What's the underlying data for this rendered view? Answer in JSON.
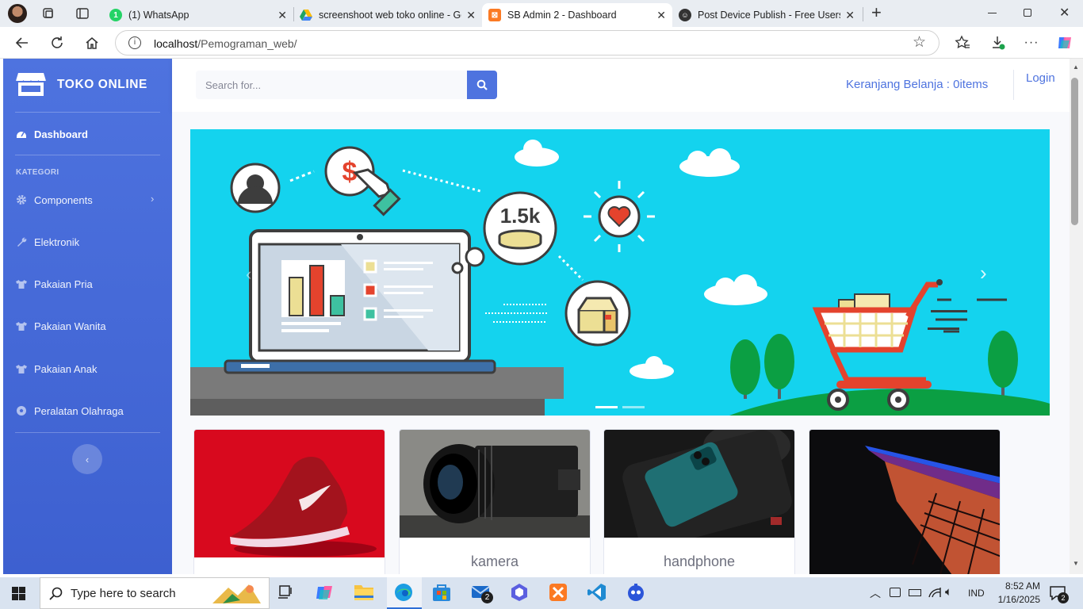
{
  "browser": {
    "tabs": [
      {
        "title": "(1) WhatsApp",
        "active": false
      },
      {
        "title": "screenshoot web toko online - Go",
        "active": false
      },
      {
        "title": "SB Admin 2 - Dashboard",
        "active": true
      },
      {
        "title": "Post Device Publish - Free Users U",
        "active": false
      }
    ],
    "url_host": "localhost",
    "url_path": "/Pemograman_web/"
  },
  "sidebar": {
    "brand": "TOKO ONLINE",
    "dashboard": "Dashboard",
    "heading": "KATEGORI",
    "items": [
      {
        "label": "Components",
        "icon": "gear-icon"
      },
      {
        "label": "Elektronik",
        "icon": "wrench-icon"
      },
      {
        "label": "Pakaian Pria",
        "icon": "shirt-icon"
      },
      {
        "label": "Pakaian Wanita",
        "icon": "shirt-icon"
      },
      {
        "label": "Pakaian Anak",
        "icon": "shirt-icon"
      },
      {
        "label": "Peralatan Olahraga",
        "icon": "ball-icon"
      }
    ]
  },
  "topbar": {
    "search_placeholder": "Search for...",
    "cart": "Keranjang Belanja : 0items",
    "login": "Login"
  },
  "carousel": {
    "badge": "1.5k",
    "slide_count": 2,
    "active_slide": 0
  },
  "products": [
    {
      "name": ""
    },
    {
      "name": "kamera"
    },
    {
      "name": "handphone"
    },
    {
      "name": ""
    }
  ],
  "taskbar": {
    "search": "Type here to search",
    "lang": "IND",
    "time": "8:52 AM",
    "date": "1/16/2025",
    "notifications": "2",
    "mail_badge": "2"
  },
  "colors": {
    "primary": "#4e73df",
    "banner": "#14d3ee"
  }
}
